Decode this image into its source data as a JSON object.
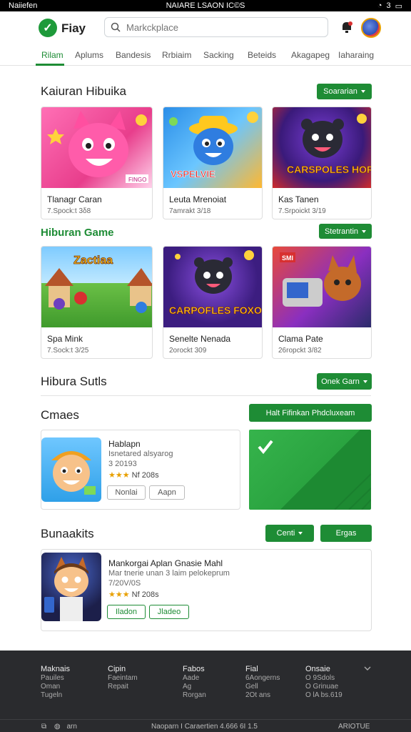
{
  "status": {
    "carrier": "Naiiefen",
    "center": "NAIARE LSAON IC©S",
    "right": "3"
  },
  "app": {
    "name": "Fiay"
  },
  "search": {
    "placeholder": "Markckplace"
  },
  "tabs": [
    {
      "label": "Rilam",
      "active": true
    },
    {
      "label": "Aplums"
    },
    {
      "label": "Bandesis"
    },
    {
      "label": "Rrbiaim"
    },
    {
      "label": "Sacking"
    },
    {
      "label": "Beteids"
    },
    {
      "label": "Akagapeg"
    },
    {
      "label": "Iaharaing"
    }
  ],
  "section1": {
    "title": "Kaiuran Hibuika",
    "button": "Soararian",
    "cards": [
      {
        "title": "Tlanagr Caran",
        "meta": "7.Spock:t 3δ8",
        "art_text": "FINGO"
      },
      {
        "title": "Leuta Mrenoiat",
        "meta": "7amrakt 3/18",
        "art_text": "VSPELVIE"
      },
      {
        "title": "Kas Tanen",
        "meta": "7.Srpoickt 3/19",
        "art_text": "CARSPOLES HORH"
      }
    ]
  },
  "section2": {
    "title": "Hiburan Game",
    "button": "Stetrantin",
    "cards": [
      {
        "title": "Spa Mink",
        "meta": "7.Sock:t 3/25",
        "art_text": "Zactiaa"
      },
      {
        "title": "Senelte Nenada",
        "meta": "2orockt 309",
        "art_text": "CARPOFLES FOXO"
      },
      {
        "title": "Clama Pate",
        "meta": "26ropckt 3/82",
        "art_text": "SMI"
      }
    ]
  },
  "section3": {
    "title": "Hibura Sutls",
    "button": "Onek Garn"
  },
  "section4": {
    "title": "Cmaes",
    "promo_button": "Halt Fifinkan Phdcluxeam",
    "app": {
      "name": "Hablapn",
      "sub": "Isnetared alsyarog",
      "version": "3 20193",
      "stars": "★★★",
      "rating": "Nf 208s",
      "btn1": "Nonlai",
      "btn2": "Aapn"
    }
  },
  "section5": {
    "title": "Bunaakits",
    "button1": "Centi",
    "button2": "Ergas",
    "app": {
      "name": "Mankorgai Aplan Gnasie Mahl",
      "sub": "Mar tnerie unan 3 laim pelokeprum",
      "version": "7/20V/0S",
      "stars": "★★★",
      "rating": "Nf 208s",
      "btn1": "Iladon",
      "btn2": "Jladeo"
    }
  },
  "footer": {
    "columns": [
      {
        "head": "Maknais",
        "links": [
          "Pauiles",
          "Oman",
          "Tugeln"
        ]
      },
      {
        "head": "Cipin",
        "links": [
          "Faeintam",
          "Repait"
        ]
      },
      {
        "head": "Fabos",
        "links": [
          "Aade",
          "Ag",
          "Rorgan"
        ]
      },
      {
        "head": "Fial",
        "links": [
          "6Aongerns",
          "Gell",
          "2Ot ans"
        ]
      },
      {
        "head": "Onsaie",
        "links": [
          "O 9Sdols",
          "O Grinuae",
          "O lA bs.619"
        ]
      }
    ],
    "bottom_left": "arn",
    "bottom_center": "Naoparn I Caraertien 4.666 6I 1.5",
    "bottom_right": "ARIOTUE"
  }
}
